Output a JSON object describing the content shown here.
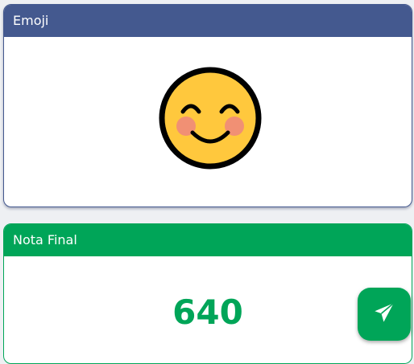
{
  "emoji_card": {
    "title": "Emoji",
    "emoji_icon": "smiling-face-with-smiling-eyes-icon"
  },
  "score_card": {
    "title": "Nota Final",
    "value": "640"
  },
  "send_button": {
    "icon": "paper-plane-icon"
  },
  "colors": {
    "emoji_header": "#44598f",
    "score_header": "#00a558",
    "score_text": "#00a558",
    "emoji_face": "#ffc83d",
    "emoji_cheeks": "#f08a7a"
  }
}
